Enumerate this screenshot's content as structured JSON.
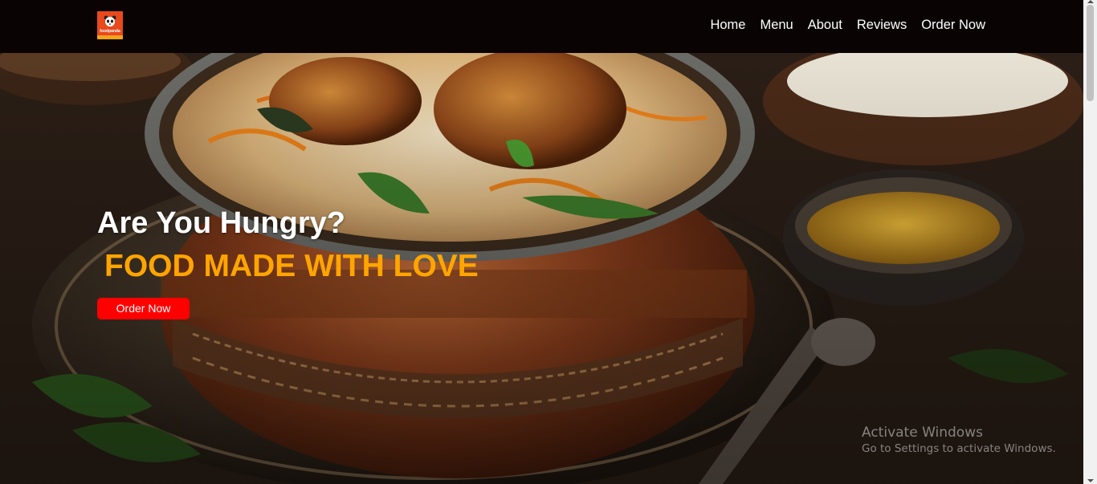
{
  "brand": {
    "logo_text": "foodpanda",
    "logo_color": "#e8491d"
  },
  "nav": {
    "items": [
      {
        "label": "Home"
      },
      {
        "label": "Menu"
      },
      {
        "label": "About"
      },
      {
        "label": "Reviews"
      },
      {
        "label": "Order Now"
      }
    ]
  },
  "hero": {
    "title": "Are You Hungry?",
    "subtitle": "FOOD MADE WITH LOVE",
    "cta_label": "Order Now",
    "subtitle_color": "#ffa500",
    "cta_color": "#ff0000",
    "background_image": "biryani-pot-photo"
  },
  "watermark": {
    "title": "Activate Windows",
    "subtitle": "Go to Settings to activate Windows."
  }
}
